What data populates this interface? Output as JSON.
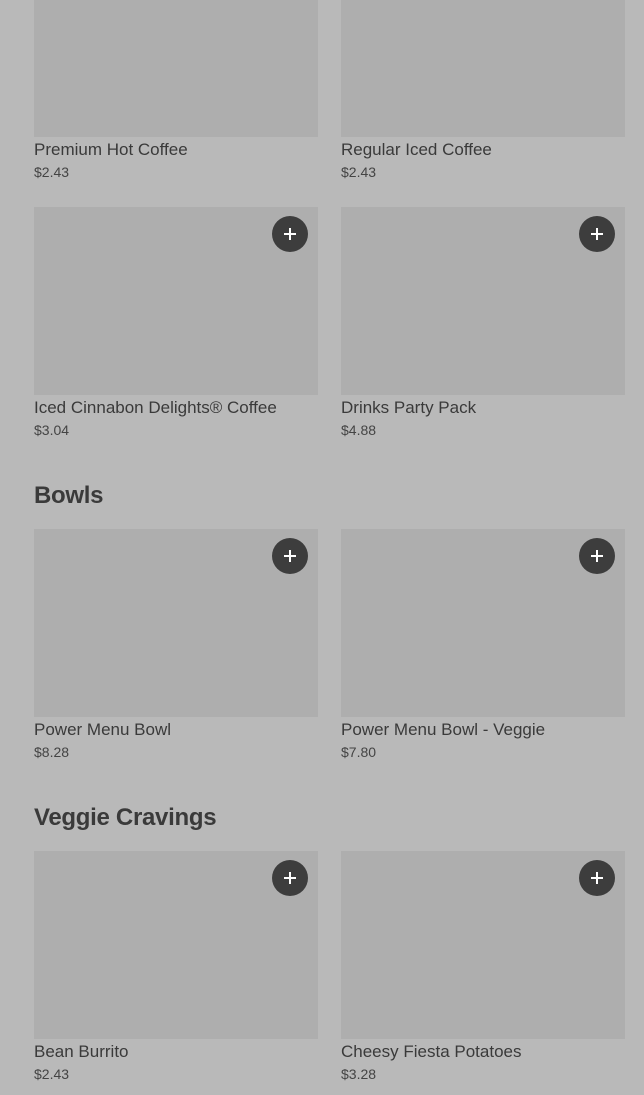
{
  "sections": [
    {
      "title": "",
      "items": [
        {
          "name": "Premium Hot Coffee",
          "price": "$2.43"
        },
        {
          "name": "Regular Iced Coffee",
          "price": "$2.43"
        },
        {
          "name": "Iced Cinnabon Delights® Coffee",
          "price": "$3.04"
        },
        {
          "name": "Drinks Party Pack",
          "price": "$4.88"
        }
      ]
    },
    {
      "title": "Bowls",
      "items": [
        {
          "name": "Power Menu Bowl",
          "price": "$8.28"
        },
        {
          "name": "Power Menu Bowl - Veggie",
          "price": "$7.80"
        }
      ]
    },
    {
      "title": "Veggie Cravings",
      "items": [
        {
          "name": "Bean Burrito",
          "price": "$2.43"
        },
        {
          "name": "Cheesy Fiesta Potatoes",
          "price": "$3.28"
        }
      ]
    }
  ],
  "icons": {
    "add": "plus-icon"
  },
  "colors": {
    "background": "#b9b9b9",
    "thumbnail": "#aeaeae",
    "add_button": "#3d3d3d"
  }
}
